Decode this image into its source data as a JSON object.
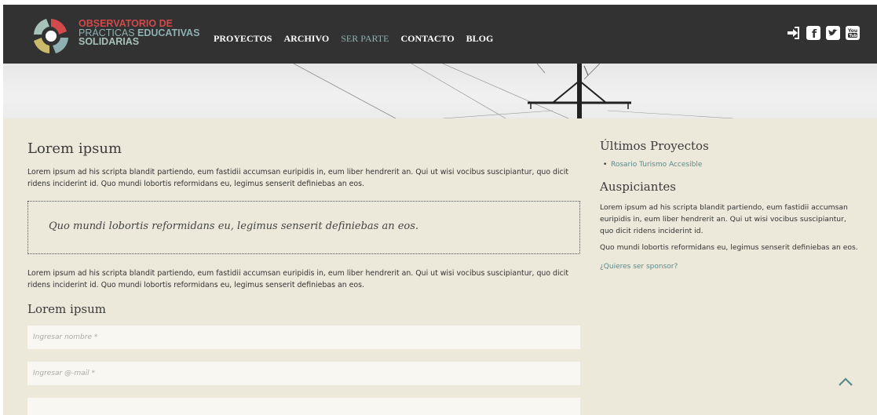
{
  "brand": {
    "line1_bold": "OBSERVATORIO",
    "line1_thin": " DE",
    "line2_thin": "PRÁCTICAS ",
    "line2_bold": "EDUCATIVAS",
    "line3": "SOLIDARIAS"
  },
  "nav": {
    "items": [
      "PROYECTOS",
      "ARCHIVO",
      "SER PARTE",
      "CONTACTO",
      "BLOG"
    ]
  },
  "social": {
    "icons": [
      "login-icon",
      "facebook-icon",
      "twitter-icon",
      "youtube-icon"
    ],
    "labels": [
      "➔",
      "f",
      "t",
      "You"
    ]
  },
  "main": {
    "title": "Lorem ipsum",
    "paragraph1": "Lorem ipsum ad his scripta blandit partiendo, eum fastidii accumsan euripidis in, eum liber hendrerit an. Qui ut wisi vocibus suscipiantur, quo dicit ridens inciderint id. Quo mundi lobortis reformidans eu, legimus senserit definiebas an eos.",
    "quote": "Quo mundi lobortis reformidans eu, legimus senserit definiebas an eos.",
    "paragraph2": "Lorem ipsum ad his scripta blandit partiendo, eum fastidii accumsan euripidis in, eum liber hendrerit an. Qui ut wisi vocibus suscipiantur, quo dicit ridens inciderint id. Quo mundi lobortis reformidans eu, legimus senserit definiebas an eos.",
    "form_title": "Lorem ipsum",
    "name_placeholder": "Ingresar nombre *",
    "email_placeholder": "Ingresar @-mail *",
    "third_placeholder": ""
  },
  "sidebar": {
    "projects_title": "Últimos Proyectos",
    "projects": [
      "Rosario Turismo Accesible"
    ],
    "sponsors_title": "Auspiciantes",
    "sponsors_p1": "Lorem ipsum ad his scripta blandit partiendo, eum fastidii accumsan euripidis in, eum liber hendrerit an. Qui ut wisi vocibus suscipiantur, quo dicit ridens inciderint id.",
    "sponsors_p2": "Quo mundi lobortis reformidans eu, legimus senserit definiebas an eos.",
    "sponsor_link": "¿Quieres ser sponsor?"
  },
  "colors": {
    "header_bg": "#323232",
    "accent_red": "#d24a4a",
    "accent_teal": "#8fb0b0",
    "content_bg": "#ece8da",
    "link": "#5b8a8a"
  }
}
